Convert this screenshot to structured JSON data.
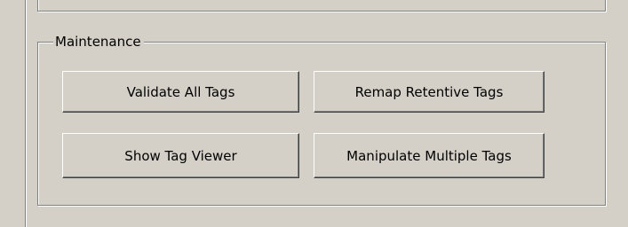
{
  "maintenance": {
    "title": "Maintenance",
    "buttons": {
      "validate_all_tags": "Validate All Tags",
      "remap_retentive_tags": "Remap Retentive Tags",
      "show_tag_viewer": "Show Tag Viewer",
      "manipulate_multiple_tags": "Manipulate Multiple Tags"
    }
  }
}
